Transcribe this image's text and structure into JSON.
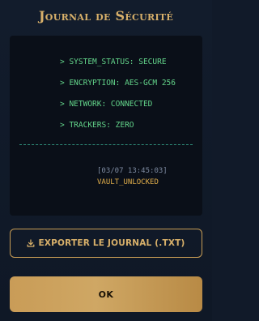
{
  "dialog": {
    "title": "Journal de Sécurité"
  },
  "terminal": {
    "lines": [
      "> SYSTEM_STATUS: SECURE",
      "> ENCRYPTION: AES-GCM 256",
      "> NETWORK: CONNECTED",
      "> TRACKERS: ZERO"
    ],
    "timestamp": "[03/07 13:45:03]",
    "event": "VAULT_UNLOCKED"
  },
  "actions": {
    "export_label": "EXPORTER LE JOURNAL (.TXT)",
    "export_icon": "download-icon",
    "ok_label": "OK"
  },
  "colors": {
    "accent_gold": "#d8b06a",
    "terminal_green": "#63d48a",
    "event_orange": "#e0ad4a",
    "background": "#111a29"
  }
}
